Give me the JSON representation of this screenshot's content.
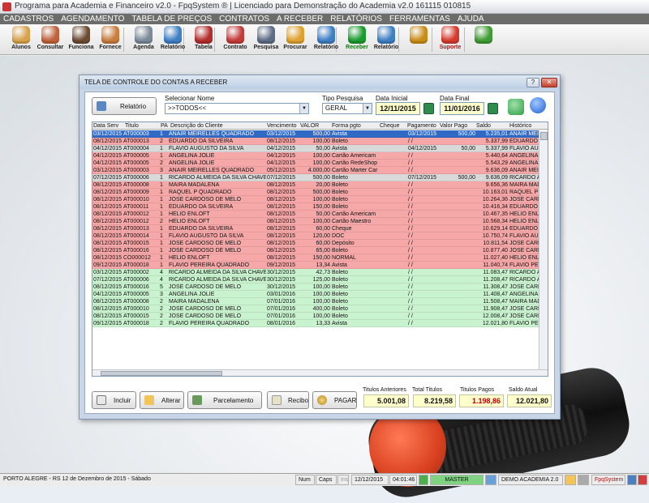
{
  "app": {
    "title": "Programa para Academia e Financeiro v2.0 - FpqSystem ® | Licenciado para  Demonstração do Academia v2.0 161115 010815"
  },
  "menu": [
    "CADASTROS",
    "AGENDAMENTO",
    "TABELA DE PREÇOS",
    "CONTRATOS",
    "A RECEBER",
    "RELATÓRIOS",
    "FERRAMENTAS",
    "AJUDA"
  ],
  "toolbar": [
    {
      "label": "Alunos",
      "icon": "students-icon",
      "color": "#d8a24a"
    },
    {
      "label": "Consultar",
      "icon": "id-card-icon",
      "color": "#c0623a"
    },
    {
      "label": "Funciona",
      "icon": "employees-icon",
      "color": "#6b4c32"
    },
    {
      "label": "Fornece",
      "icon": "supplier-icon",
      "color": "#c97c3c"
    },
    {
      "label": "Agenda",
      "icon": "magnifier-agenda-icon",
      "color": "#7a8a99"
    },
    {
      "label": "Relatório",
      "icon": "report-icon",
      "color": "#3f7fc4"
    },
    {
      "label": "Tabela",
      "icon": "table-icon",
      "color": "#b32d2d"
    },
    {
      "label": "Contrato",
      "icon": "contract-icon",
      "color": "#c43b3b"
    },
    {
      "label": "Pesquisa",
      "icon": "search-icon",
      "color": "#5d6d84"
    },
    {
      "label": "Procurar",
      "icon": "folder-icon",
      "color": "#e0a12e"
    },
    {
      "label": "Relatório",
      "icon": "report-icon",
      "color": "#3f7fc4"
    },
    {
      "label": "Receber",
      "icon": "dollar-icon",
      "color": "#1a9b2e",
      "labelClass": "green"
    },
    {
      "label": "Relatório",
      "icon": "report-icon",
      "color": "#3f7fc4"
    },
    {
      "label": "",
      "icon": "coins-icon",
      "color": "#c98d16"
    },
    {
      "label": "Suporte",
      "icon": "support-icon",
      "color": "#d53a2c",
      "labelClass": "red"
    },
    {
      "label": "",
      "icon": "exit-icon",
      "color": "#3f9b33"
    }
  ],
  "window": {
    "title": "TELA DE CONTROLE DO CONTAS A RECEBER",
    "help_label": "?",
    "close_label": "✕",
    "relatorio_label": "Relatório",
    "selecionar_nome_label": "Selecionar Nome",
    "selecionar_nome_value": ">>TODOS<<",
    "tipo_pesquisa_label": "Tipo  Pesquisa",
    "tipo_pesquisa_value": "GERAL",
    "data_inicial_label": "Data Inicial",
    "data_inicial_value": "12/11/2015",
    "data_final_label": "Data Final",
    "data_final_value": "11/01/2016"
  },
  "grid": {
    "columns": [
      "Data Serv",
      "Titulo",
      "PA",
      "Descrição do Cliente",
      "Vencimento",
      "VALOR",
      "Forma pgto",
      "Cheque",
      "Pagamento",
      "Valor Pago",
      "Saldo",
      "Histórico"
    ],
    "rows": [
      {
        "data": "03/12/2015",
        "titulo": "AT000003",
        "pa": "1",
        "cliente": "ANAIR MEIRELLES QUADRADO",
        "venc": "03/12/2015",
        "valor": "500,00",
        "forma": "Avista",
        "cheque": "",
        "pag": "03/12/2015",
        "vpago": "500,00",
        "saldo": "5.235,01",
        "hist": "ANAIR MEIREL",
        "status": "selected"
      },
      {
        "data": "08/12/2015",
        "titulo": "AT000013",
        "pa": "2",
        "cliente": "EDUARDO DA SILVEIRA",
        "venc": "08/12/2015",
        "valor": "100,00",
        "forma": "Boleto",
        "cheque": "",
        "pag": "/ /",
        "vpago": "",
        "saldo": "5.337,99",
        "hist": "EDUARDO DA",
        "status": "open"
      },
      {
        "data": "04/12/2015",
        "titulo": "AT000004",
        "pa": "1",
        "cliente": "FLAVIO AUGUSTO DA SILVA",
        "venc": "04/12/2015",
        "valor": "50,00",
        "forma": "Avista",
        "cheque": "",
        "pag": "04/12/2015",
        "vpago": "50,00",
        "saldo": "5.337,99",
        "hist": "FLAVIO AUGU",
        "status": "paid"
      },
      {
        "data": "04/12/2015",
        "titulo": "AT000005",
        "pa": "1",
        "cliente": "ANGELINA JOLIE",
        "venc": "04/12/2015",
        "valor": "100,00",
        "forma": "Cartão Americam",
        "cheque": "",
        "pag": "/ /",
        "vpago": "",
        "saldo": "5.440,64",
        "hist": "ANGELINA JO",
        "status": "open"
      },
      {
        "data": "04/12/2015",
        "titulo": "AT000005",
        "pa": "2",
        "cliente": "ANGELINA JOLIE",
        "venc": "04/12/2015",
        "valor": "100,00",
        "forma": "Cartão RedeShop",
        "cheque": "",
        "pag": "/ /",
        "vpago": "",
        "saldo": "5.543,29",
        "hist": "ANGELINA JO",
        "status": "open"
      },
      {
        "data": "03/12/2015",
        "titulo": "AT000003",
        "pa": "3",
        "cliente": "ANAIR MEIRELLES QUADRADO",
        "venc": "05/12/2015",
        "valor": "4.000,00",
        "forma": "Cartão Marter Car",
        "cheque": "",
        "pag": "/ /",
        "vpago": "",
        "saldo": "9.636,09",
        "hist": "ANAIR MEIREL",
        "status": "open"
      },
      {
        "data": "07/12/2015",
        "titulo": "AT000006",
        "pa": "1",
        "cliente": "RICARDO ALMEIDA DA SILVA CHAVE",
        "venc": "07/12/2015",
        "valor": "500,00",
        "forma": "Boleto",
        "cheque": "",
        "pag": "07/12/2015",
        "vpago": "500,00",
        "saldo": "9.636,09",
        "hist": "RICARDO ALM",
        "status": "paid"
      },
      {
        "data": "08/12/2015",
        "titulo": "AT000008",
        "pa": "1",
        "cliente": "MAIRA MADALENA",
        "venc": "08/12/2015",
        "valor": "20,00",
        "forma": "Boleto",
        "cheque": "",
        "pag": "/ /",
        "vpago": "",
        "saldo": "9.656,36",
        "hist": "MAIRA MADAL",
        "status": "open"
      },
      {
        "data": "08/12/2015",
        "titulo": "AT000009",
        "pa": "1",
        "cliente": "RAQUEL P QUADRADO",
        "venc": "08/12/2015",
        "valor": "500,00",
        "forma": "Boleto",
        "cheque": "",
        "pag": "/ /",
        "vpago": "",
        "saldo": "10.163,01",
        "hist": "RAQUEL P QU",
        "status": "open"
      },
      {
        "data": "08/12/2015",
        "titulo": "AT000010",
        "pa": "1",
        "cliente": "JOSE CARDOSO DE MELO",
        "venc": "08/12/2015",
        "valor": "100,00",
        "forma": "Boleto",
        "cheque": "",
        "pag": "/ /",
        "vpago": "",
        "saldo": "10.264,36",
        "hist": "JOSE CARDOS",
        "status": "open"
      },
      {
        "data": "08/12/2015",
        "titulo": "AT000011",
        "pa": "1",
        "cliente": "EDUARDO DA SILVEIRA",
        "venc": "08/12/2015",
        "valor": "150,00",
        "forma": "Boleto",
        "cheque": "",
        "pag": "/ /",
        "vpago": "",
        "saldo": "10.416,34",
        "hist": "EDUARDO DA",
        "status": "open"
      },
      {
        "data": "08/12/2015",
        "titulo": "AT000012",
        "pa": "1",
        "cliente": "HELIO ENLOFT",
        "venc": "08/12/2015",
        "valor": "50,00",
        "forma": "Cartão Americam",
        "cheque": "",
        "pag": "/ /",
        "vpago": "",
        "saldo": "10.467,35",
        "hist": "HELIO ENLOF",
        "status": "open"
      },
      {
        "data": "08/12/2015",
        "titulo": "AT000012",
        "pa": "2",
        "cliente": "HELIO ENLOFT",
        "venc": "08/12/2015",
        "valor": "100,00",
        "forma": "Cartão Maestro",
        "cheque": "",
        "pag": "/ /",
        "vpago": "",
        "saldo": "10.568,34",
        "hist": "HELIO ENLOF",
        "status": "open"
      },
      {
        "data": "08/12/2015",
        "titulo": "AT000013",
        "pa": "1",
        "cliente": "EDUARDO DA SILVEIRA",
        "venc": "08/12/2015",
        "valor": "60,00",
        "forma": "Cheque",
        "cheque": "",
        "pag": "/ /",
        "vpago": "",
        "saldo": "10.629,14",
        "hist": "EDUARDO DA",
        "status": "open"
      },
      {
        "data": "08/12/2015",
        "titulo": "AT000014",
        "pa": "1",
        "cliente": "FLAVIO AUGUSTO DA SILVA",
        "venc": "08/12/2015",
        "valor": "120,00",
        "forma": "DOC",
        "cheque": "",
        "pag": "/ /",
        "vpago": "",
        "saldo": "10.750,74",
        "hist": "FLAVIO AUGU",
        "status": "open"
      },
      {
        "data": "08/12/2015",
        "titulo": "AT000015",
        "pa": "1",
        "cliente": "JOSE CARDOSO DE MELO",
        "venc": "08/12/2015",
        "valor": "60,00",
        "forma": "Depósito",
        "cheque": "",
        "pag": "/ /",
        "vpago": "",
        "saldo": "10.811,54",
        "hist": "JOSE CARDOS",
        "status": "open"
      },
      {
        "data": "08/12/2015",
        "titulo": "AT000016",
        "pa": "1",
        "cliente": "JOSE CARDOSO DE MELO",
        "venc": "08/12/2015",
        "valor": "65,00",
        "forma": "Boleto",
        "cheque": "",
        "pag": "/ /",
        "vpago": "",
        "saldo": "10.877,40",
        "hist": "JOSE CARDOS",
        "status": "open"
      },
      {
        "data": "08/12/2015",
        "titulo": "CO000012",
        "pa": "1",
        "cliente": "HELIO ENLOFT",
        "venc": "08/12/2015",
        "valor": "150,00",
        "forma": "NORMAL",
        "cheque": "",
        "pag": "/ /",
        "vpago": "",
        "saldo": "11.027,40",
        "hist": "HELIO ENLOF",
        "status": "open"
      },
      {
        "data": "09/12/2015",
        "titulo": "AT000018",
        "pa": "1",
        "cliente": "FLAVIO PEREIRA QUADRADO",
        "venc": "09/12/2015",
        "valor": "13,34",
        "forma": "Avista",
        "cheque": "",
        "pag": "/ /",
        "vpago": "",
        "saldo": "11.040,74",
        "hist": "FLAVIO PEREI",
        "status": "open"
      },
      {
        "data": "03/12/2015",
        "titulo": "AT000002",
        "pa": "4",
        "cliente": "RICARDO ALMEIDA DA SILVA CHAVE",
        "venc": "30/12/2015",
        "valor": "42,73",
        "forma": "Boleto",
        "cheque": "",
        "pag": "/ /",
        "vpago": "",
        "saldo": "11.083,47",
        "hist": "RICARDO ALM",
        "status": "future"
      },
      {
        "data": "07/12/2015",
        "titulo": "AT000006",
        "pa": "4",
        "cliente": "RICARDO ALMEIDA DA SILVA CHAVE",
        "venc": "30/12/2015",
        "valor": "125,00",
        "forma": "Boleto",
        "cheque": "",
        "pag": "/ /",
        "vpago": "",
        "saldo": "11.208,47",
        "hist": "RICARDO ALM",
        "status": "future"
      },
      {
        "data": "08/12/2015",
        "titulo": "AT000016",
        "pa": "5",
        "cliente": "JOSE CARDOSO DE MELO",
        "venc": "30/12/2015",
        "valor": "100,00",
        "forma": "Boleto",
        "cheque": "",
        "pag": "/ /",
        "vpago": "",
        "saldo": "11.308,47",
        "hist": "JOSE CARDOS",
        "status": "future"
      },
      {
        "data": "04/12/2015",
        "titulo": "AT000005",
        "pa": "3",
        "cliente": "ANGELINA JOLIE",
        "venc": "03/01/2016",
        "valor": "100,00",
        "forma": "Boleto",
        "cheque": "",
        "pag": "/ /",
        "vpago": "",
        "saldo": "11.408,47",
        "hist": "ANGELINA JO",
        "status": "future"
      },
      {
        "data": "08/12/2015",
        "titulo": "AT000008",
        "pa": "2",
        "cliente": "MAIRA MADALENA",
        "venc": "07/01/2016",
        "valor": "100,00",
        "forma": "Boleto",
        "cheque": "",
        "pag": "/ /",
        "vpago": "",
        "saldo": "11.508,47",
        "hist": "MAIRA MADAL",
        "status": "future"
      },
      {
        "data": "08/12/2015",
        "titulo": "AT000010",
        "pa": "2",
        "cliente": "JOSE CARDOSO DE MELO",
        "venc": "07/01/2016",
        "valor": "400,00",
        "forma": "Boleto",
        "cheque": "",
        "pag": "/ /",
        "vpago": "",
        "saldo": "11.908,47",
        "hist": "JOSE CARDOS",
        "status": "future"
      },
      {
        "data": "08/12/2015",
        "titulo": "AT000015",
        "pa": "2",
        "cliente": "JOSE CARDOSO DE MELO",
        "venc": "07/01/2016",
        "valor": "100,00",
        "forma": "Boleto",
        "cheque": "",
        "pag": "/ /",
        "vpago": "",
        "saldo": "12.008,47",
        "hist": "JOSE CARDOS",
        "status": "future"
      },
      {
        "data": "09/12/2015",
        "titulo": "AT000018",
        "pa": "2",
        "cliente": "FLAVIO PEREIRA QUADRADO",
        "venc": "08/01/2016",
        "valor": "13,33",
        "forma": "Avista",
        "cheque": "",
        "pag": "/ /",
        "vpago": "",
        "saldo": "12.021,80",
        "hist": "FLAVIO PEREI",
        "status": "future"
      }
    ]
  },
  "status_colors": {
    "selected": "#316ac5",
    "open": "#f6a8a8",
    "paid": "#d9d9d9",
    "future": "#c9f2cf"
  },
  "actions": {
    "incluir": "Incluir",
    "alterar": "Alterar",
    "parcelamento": "Parcelamento",
    "recibo": "Recibo",
    "pagar": "PAGAR"
  },
  "totals": {
    "titulos_anteriores_label": "Titulos Anteriores",
    "titulos_anteriores": "5.001,08",
    "total_titulos_label": "Total Titulos",
    "total_titulos": "8.219,58",
    "titulos_pagos_label": "Titulos Pagos",
    "titulos_pagos": "1.198,86",
    "saldo_atual_label": "Saldo Atual",
    "saldo_atual": "12.021,80"
  },
  "statusbar": {
    "location": "PORTO ALEGRE - RS 12 de Dezembro de 2015 - Sábado",
    "num": "Num",
    "caps": "Caps",
    "ins": "Ins",
    "date": "12/12/2015",
    "time": "04:01:46",
    "db": "MASTER",
    "company": "DEMO ACADEMIA 2.0",
    "brand": "FpqSystem"
  }
}
